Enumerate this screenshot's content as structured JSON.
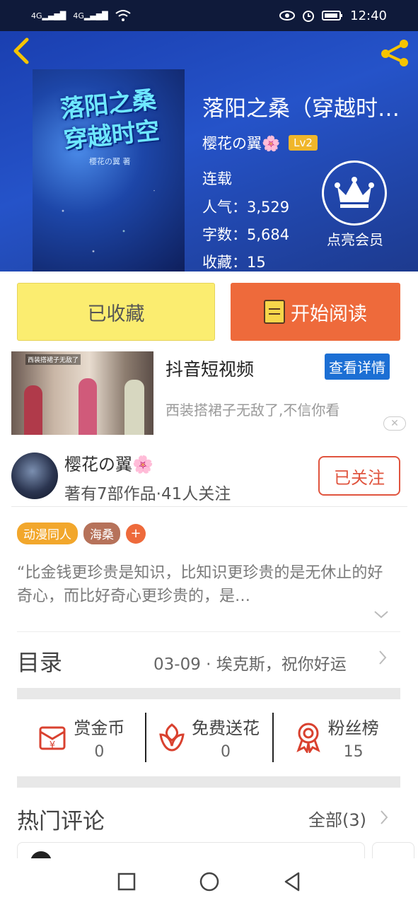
{
  "status_bar": {
    "net1": "4G",
    "net2": "4G",
    "time": "12:40"
  },
  "book": {
    "title": "落阳之桑（穿越时空）",
    "cover_title_line1": "落阳之桑",
    "cover_title_line2": "穿越时空",
    "cover_author": "樱花の翼 著",
    "author": "樱花の翼🌸",
    "level": "Lv2",
    "status": "连载",
    "popularity_label": "人气：",
    "popularity": "3,529",
    "words_label": "字数：",
    "words": "5,684",
    "favorites_label": "收藏：",
    "favorites": "15",
    "vip_label": "点亮会员"
  },
  "actions": {
    "collected": "已收藏",
    "start_reading": "开始阅读"
  },
  "ad": {
    "thumb_caption": "西装搭裙子无敌了",
    "title": "抖音短视频",
    "detail_button": "查看详情",
    "description": "西装搭裙子无敌了,不信你看",
    "close": "✕"
  },
  "author_card": {
    "name": "樱花の翼🌸",
    "subtitle": "著有7部作品·41人关注",
    "follow_button": "已关注"
  },
  "tags": [
    "动漫同人",
    "海桑"
  ],
  "tag_add": "+",
  "intro_quote": "“比金钱更珍贵是知识，比知识更珍贵的是无休止的好奇心，而比好奇心更珍贵的，是…",
  "toc": {
    "label": "目录",
    "latest": "03-09 · 埃克斯，祝你好运"
  },
  "stats": [
    {
      "label": "赏金币",
      "value": "0",
      "icon": "red-envelope-yuan-icon"
    },
    {
      "label": "免费送花",
      "value": "0",
      "icon": "flower-icon"
    },
    {
      "label": "粉丝榜",
      "value": "15",
      "icon": "award-ribbon-icon"
    }
  ],
  "hot_comments": {
    "title": "热门评论",
    "all": "全部(3)"
  },
  "colors": {
    "accent_orange": "#ee6a3b",
    "collect_yellow": "#fbed70",
    "header_blue": "#2553c9",
    "follow_red": "#e0543e"
  }
}
